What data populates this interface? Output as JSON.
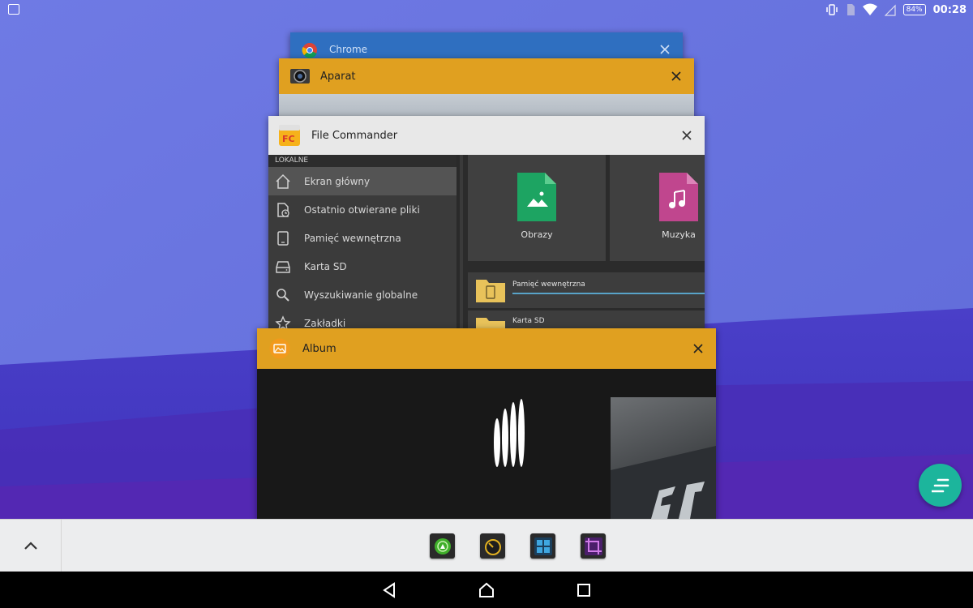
{
  "status_bar": {
    "battery": "84%",
    "clock": "00:28"
  },
  "recents": {
    "cards": [
      {
        "title": "Chrome",
        "color": "#2f6fc0"
      },
      {
        "title": "Aparat",
        "color": "#e0a020"
      },
      {
        "title": "File Commander",
        "color": "#e8e8e8"
      },
      {
        "title": "Album",
        "color": "#e0a020"
      }
    ]
  },
  "file_commander": {
    "section_label": "LOKALNE",
    "sidebar_items": [
      {
        "label": "Ekran główny",
        "icon": "home-icon"
      },
      {
        "label": "Ostatnio otwierane pliki",
        "icon": "recent-files-icon"
      },
      {
        "label": "Pamięć wewnętrzna",
        "icon": "tablet-icon"
      },
      {
        "label": "Karta SD",
        "icon": "sd-card-icon"
      },
      {
        "label": "Wyszukiwanie globalne",
        "icon": "search-icon"
      },
      {
        "label": "Zakładki",
        "icon": "star-icon"
      }
    ],
    "tiles": [
      {
        "label": "Obrazy",
        "color": "#1da462"
      },
      {
        "label": "Muzyka",
        "color": "#c0468e"
      }
    ],
    "storage": [
      {
        "label": "Pamięć wewnętrzna"
      },
      {
        "label": "Karta SD"
      }
    ]
  },
  "colors": {
    "accent_orange": "#e0a020",
    "fab": "#1cb59c",
    "folder": "#e8c25a"
  },
  "small_apps": [
    "browser-small-app-icon",
    "timer-small-app-icon",
    "calculator-small-app-icon",
    "screen-capture-small-app-icon"
  ],
  "navigation": [
    "back-icon",
    "home-icon",
    "recents-icon"
  ]
}
